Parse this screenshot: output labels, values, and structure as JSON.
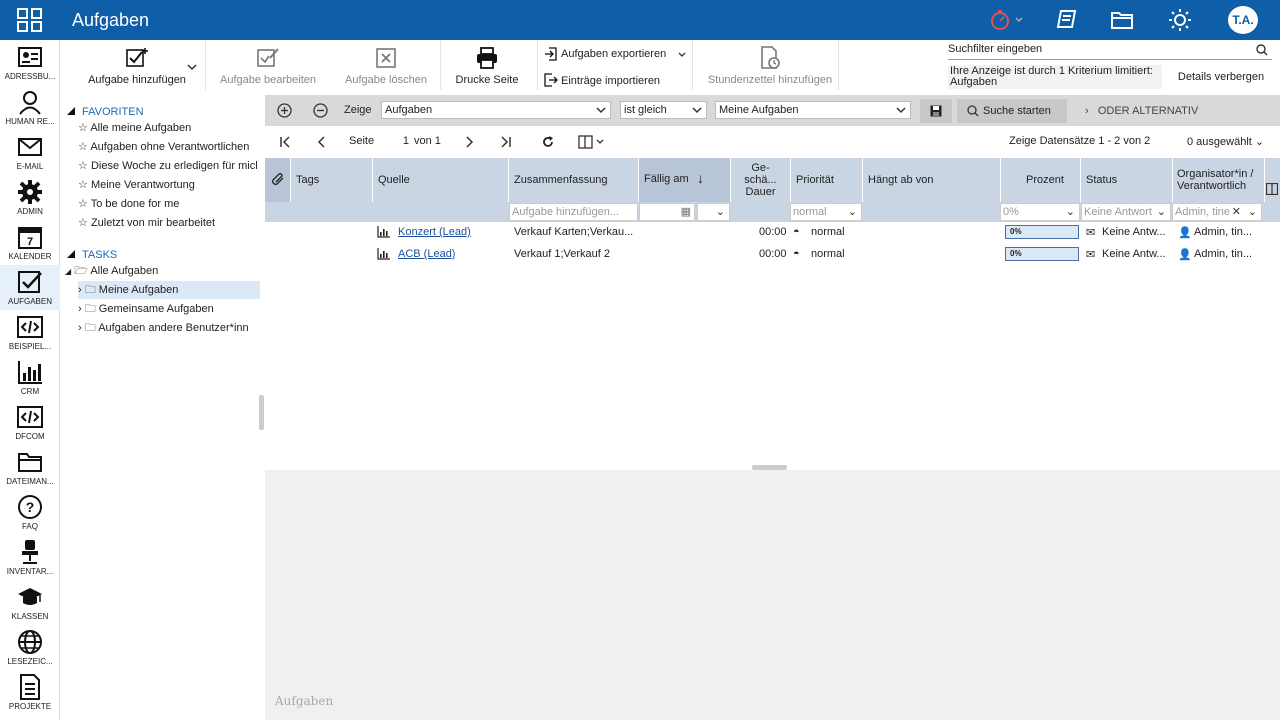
{
  "app": {
    "title": "Aufgaben",
    "avatar": "T.A.",
    "accent": "#0f5ea8"
  },
  "nav": [
    {
      "label": "ADRESSBU...",
      "icon": "addressbook-icon"
    },
    {
      "label": "HUMAN RE...",
      "icon": "person-icon"
    },
    {
      "label": "E-MAIL",
      "icon": "mail-icon"
    },
    {
      "label": "ADMIN",
      "icon": "gear-icon"
    },
    {
      "label": "KALENDER",
      "icon": "calendar-icon"
    },
    {
      "label": "AUFGABEN",
      "icon": "task-check-icon"
    },
    {
      "label": "BEISPIEL...",
      "icon": "code-icon"
    },
    {
      "label": "CRM",
      "icon": "bar-chart-icon"
    },
    {
      "label": "DFCOM",
      "icon": "code-icon"
    },
    {
      "label": "DATEIMAN...",
      "icon": "folder-icon"
    },
    {
      "label": "FAQ",
      "icon": "question-icon"
    },
    {
      "label": "INVENTAR...",
      "icon": "office-chair-icon"
    },
    {
      "label": "KLASSEN",
      "icon": "graduation-cap-icon"
    },
    {
      "label": "LESEZEIC...",
      "icon": "globe-icon"
    },
    {
      "label": "PROJEKTE",
      "icon": "document-icon"
    }
  ],
  "toolbar": {
    "add": "Aufgabe hinzufügen",
    "edit": "Aufgabe bearbeiten",
    "delete": "Aufgabe löschen",
    "print": "Drucke Seite",
    "export": "Aufgaben exportieren",
    "import": "Einträge importieren",
    "timesheet": "Stundenzettel hinzufügen"
  },
  "search": {
    "placeholder": "Suchfilter eingeben",
    "limit_note": "Ihre Anzeige ist durch 1 Kriterium limitiert: Aufgaben",
    "details_button": "Details verbergen"
  },
  "tree": {
    "favorites_header": "FAVORITEN",
    "favorites": [
      "Alle meine Aufgaben",
      "Aufgaben ohne Verantwortlichen",
      "Diese Woche zu erledigen für micl",
      "Meine Verantwortung",
      "To be done for me",
      "Zuletzt von mir bearbeitet"
    ],
    "tasks_header": "TASKS",
    "root": "Alle Aufgaben",
    "folders": [
      "Meine Aufgaben",
      "Gemeinsame Aufgaben",
      "Aufgaben andere Benutzer*inn"
    ]
  },
  "filter": {
    "show_label": "Zeige",
    "field": "Aufgaben",
    "operator": "ist gleich",
    "value": "Meine Aufgaben",
    "search_button": "Suche starten",
    "alternative": "ODER ALTERNATIV"
  },
  "pager": {
    "page_label": "Seite",
    "page": "1",
    "of": "von 1",
    "records": "Zeige Datensätze 1 - 2 von 2",
    "selected": "0 ausgewählt"
  },
  "columns": {
    "tags": "Tags",
    "source": "Quelle",
    "summary": "Zusammenfassung",
    "due": "Fällig am",
    "duration": "Ge-\nschä...\nDauer",
    "priority": "Priorität",
    "depends": "Hängt ab von",
    "percent": "Prozent",
    "status": "Status",
    "organizer": "Organisator*in / Verantwortlich"
  },
  "filter_row": {
    "summary_placeholder": "Aufgabe hinzufügen...",
    "priority": "normal",
    "percent": "0%",
    "status": "Keine Antwort",
    "organizer": "Admin, tine"
  },
  "rows": [
    {
      "source": "Konzert (Lead)",
      "summary": "Verkauf Karten;Verkau...",
      "duration": "00:00",
      "priority": "normal",
      "percent": "0%",
      "status": "Keine Antw...",
      "organizer": "Admin, tin..."
    },
    {
      "source": "ACB (Lead)",
      "summary": "Verkauf 1;Verkauf 2",
      "duration": "00:00",
      "priority": "normal",
      "percent": "0%",
      "status": "Keine Antw...",
      "organizer": "Admin, tin..."
    }
  ],
  "bottom": {
    "placeholder": "Aufgaben"
  }
}
